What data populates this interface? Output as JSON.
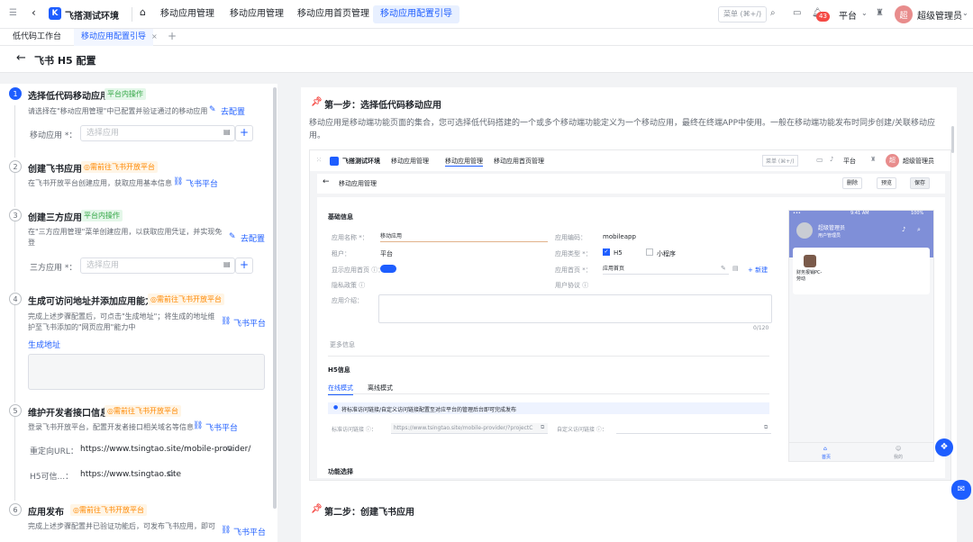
{
  "topbar": {
    "brand": "飞搭测试环境",
    "nav": [
      "移动应用管理",
      "移动应用管理",
      "移动应用首页管理",
      "移动应用配置引导"
    ],
    "search_placeholder": "菜单 (⌘+/)",
    "notif_count": "43",
    "platform": "平台",
    "avatar": "超",
    "user": "超级管理员"
  },
  "tabs": {
    "items": [
      "低代码工作台",
      "移动应用配置引导"
    ],
    "add": "+"
  },
  "page": {
    "back": "←",
    "title": "飞书 H5 配置"
  },
  "steps": [
    {
      "num": "1",
      "title": "选择低代码移动应用",
      "tag": "平台内操作",
      "desc": "请选择在\"移动应用管理\"中已配置并验证通过的移动应用",
      "link": "去配置",
      "field_label": "移动应用 *：",
      "field_placeholder": "选择应用"
    },
    {
      "num": "2",
      "title": "创建飞书应用",
      "tag": "◎需前往飞书开放平台",
      "desc": "在飞书开放平台创建应用，获取应用基本信息",
      "link": "飞书平台"
    },
    {
      "num": "3",
      "title": "创建三方应用",
      "tag": "平台内操作",
      "desc_lines": [
        "在\"三方应用管理\"菜单创建应用，以获取应用凭证，并实现免",
        "登"
      ],
      "link": "去配置",
      "field_label": "三方应用 *：",
      "field_placeholder": "选择应用"
    },
    {
      "num": "4",
      "title": "生成可访问地址并添加应用能力",
      "tag": "◎需前往飞书开放平台",
      "desc_lines": [
        "完成上述步骤配置后，可点击\"生成地址\"；将生成的地址维",
        "护至飞书添加的\"网页应用\"能力中"
      ],
      "link": "飞书平台",
      "action": "生成地址"
    },
    {
      "num": "5",
      "title": "维护开发者接口信息",
      "tag": "◎需前往飞书开放平台",
      "desc": "登录飞书开放平台，配置开发者接口相关域名等信息",
      "link": "飞书平台",
      "redirect_label": "重定向URL：",
      "redirect_value": "https://www.tsingtao.site/mobile-provider/",
      "h5_label": "H5可信...：",
      "h5_value": "https://www.tsingtao.site"
    },
    {
      "num": "6",
      "title": "应用发布",
      "tag": "◎需前往飞书开放平台",
      "desc": "完成上述步骤配置并已验证功能后，可发布飞书应用，即可",
      "link": "飞书平台"
    }
  ],
  "right": {
    "step1_title": "第一步：选择低代码移动应用",
    "step1_desc_lines": [
      "移动应用是移动端功能页面的集合，您可选择低代码搭建的一个或多个移动端功能定义为一个移动应用，最终在终端APP中使用。一般在移动端功能发布时同步创建/关联移动应",
      "用。"
    ],
    "step2_title": "第二步：创建飞书应用"
  },
  "mock": {
    "brand": "飞搭测试环境",
    "nav": [
      "移动应用管理",
      "移动应用管理",
      "移动应用首页管理"
    ],
    "search": "菜单 (⌘+/)",
    "platform": "平台",
    "user": "超级管理员",
    "avatar": "超",
    "page_title": "移动应用管理",
    "btn_delete": "删除",
    "btn_preview": "预览",
    "btn_save": "保存",
    "section_basic": "基础信息",
    "app_name_label": "应用名称 *：",
    "app_name_value": "移动应用",
    "app_code_label": "应用编码：",
    "app_code_value": "mobileapp",
    "tenant_label": "租户：",
    "tenant_value": "平台",
    "app_type_label": "应用类型 *：",
    "type_h5": "H5",
    "type_mini": "小程序",
    "show_home_label": "显示应用首页 ⓘ：",
    "home_label": "应用首页 *：",
    "home_value": "应用首页",
    "new_link": "+ 新建",
    "privacy_label": "隐私政策 ⓘ",
    "agreement_label": "用户协议 ⓘ",
    "intro_label": "应用介绍：",
    "counter": "0/120",
    "more_info": "更多信息",
    "section_h5": "H5信息",
    "tab_online": "在线模式",
    "tab_offline": "离线模式",
    "notice": "将标准访问链接/自定义访问链接配置至对应平台的管理后台即可完成发布",
    "std_link_label": "标准访问链接 ⓘ：",
    "std_link_value": "https://www.tsingtao.site/mobile-provider/?projectC",
    "custom_link_label": "自定义访问链接 ⓘ：",
    "section_func": "功能选择",
    "phone_time": "9:41 AM",
    "phone_battery": "100%",
    "phone_user": "超级管理员",
    "phone_sub": "用户管理员",
    "phone_card": "财务报销PC-劳动",
    "phone_nav_home": "首页",
    "phone_nav_mine": "我的"
  },
  "colors": {
    "accent": "#1e5eff",
    "green": "#32a645",
    "orange": "#ff8800",
    "badge": "#f54a45"
  }
}
